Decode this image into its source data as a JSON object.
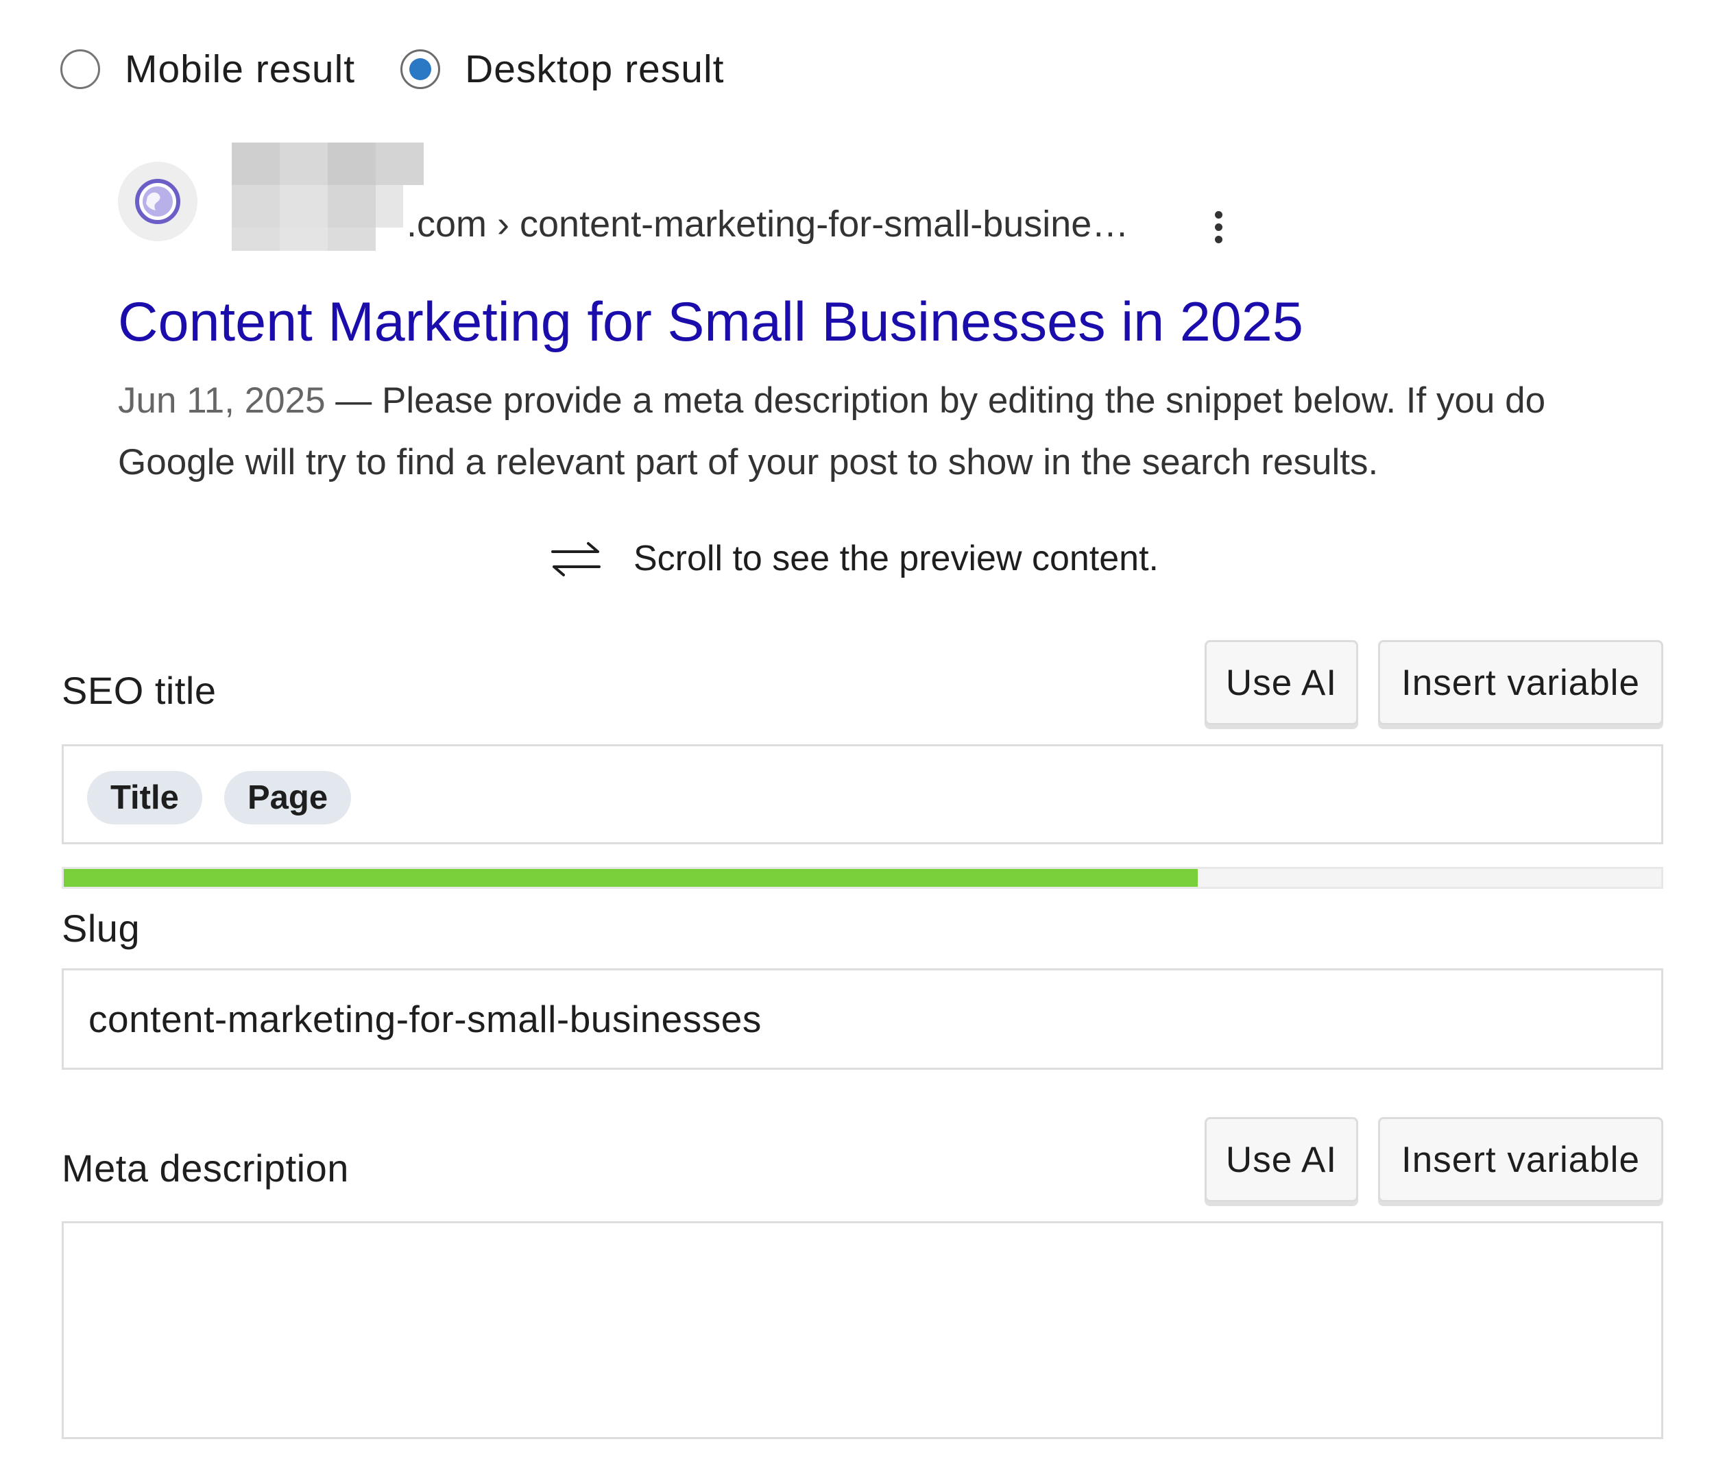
{
  "preview_mode": {
    "options": [
      {
        "label": "Mobile result",
        "selected": false
      },
      {
        "label": "Desktop result",
        "selected": true
      }
    ]
  },
  "snippet": {
    "favicon_icon": "globe-icon",
    "url_breadcrumb": ".com › content-marketing-for-small-busine…",
    "more_icon": "vertical-dots-icon",
    "title": "Content Marketing for Small Businesses in 2025",
    "date": "Jun 11, 2025",
    "date_separator": " — ",
    "description_line1": "Please provide a meta description by editing the snippet below. If you do",
    "description_line2": "Google will try to find a relevant part of your post to show in the search results.",
    "title_color": "#1a0dab"
  },
  "scroll_hint": {
    "icon": "swap-arrows-icon",
    "text": "Scroll to see the preview content."
  },
  "seo_title": {
    "label": "SEO title",
    "use_ai_label": "Use AI",
    "insert_variable_label": "Insert variable",
    "chips": [
      "Title",
      "Page"
    ],
    "length_progress": 0.71,
    "progress_color": "#7ad03a"
  },
  "slug": {
    "label": "Slug",
    "value": "content-marketing-for-small-businesses"
  },
  "meta_description": {
    "label": "Meta description",
    "use_ai_label": "Use AI",
    "insert_variable_label": "Insert variable",
    "value": ""
  }
}
